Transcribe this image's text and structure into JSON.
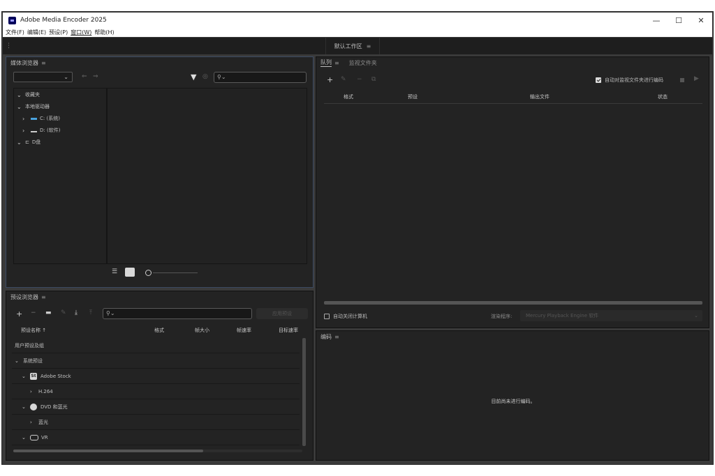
{
  "window": {
    "title": "Adobe Media Encoder 2025",
    "minimize": "—",
    "maximize": "☐",
    "close": "✕"
  },
  "menu": [
    "文件(F)",
    "编辑(E)",
    "预设(P)",
    "窗口(W)",
    "帮助(H)"
  ],
  "workspace": {
    "tab_label": "默认工作区",
    "menu_glyph": "≡"
  },
  "media_browser": {
    "title": "媒体浏览器",
    "menu_glyph": "≡",
    "tree": [
      {
        "label": "收藏夹",
        "arrow": "⌄",
        "level": 0
      },
      {
        "label": "本地驱动器",
        "arrow": "⌄",
        "level": 0
      },
      {
        "label": "C: (系统)",
        "arrow": "›",
        "level": 1
      },
      {
        "label": "D: (软件)",
        "arrow": "›",
        "level": 1
      },
      {
        "label": "D盘",
        "arrow": "⌄",
        "level": 0
      }
    ]
  },
  "preset_browser": {
    "title": "预设浏览器",
    "menu_glyph": "≡",
    "apply_button": "应用预设",
    "columns": [
      "预设名称 ↑",
      "格式",
      "帧大小",
      "帧速率",
      "目标速率"
    ],
    "rows": [
      {
        "label": "用户预设及组",
        "arrow": "",
        "icon": "",
        "indent": 0
      },
      {
        "label": "系统预设",
        "arrow": "⌄",
        "icon": "",
        "indent": 0
      },
      {
        "label": "Adobe Stock",
        "arrow": "⌄",
        "icon": "St",
        "indent": 1
      },
      {
        "label": "H.264",
        "arrow": "›",
        "icon": "",
        "indent": 2
      },
      {
        "label": "DVD 和蓝光",
        "arrow": "⌄",
        "icon": "disc",
        "indent": 1
      },
      {
        "label": "蓝光",
        "arrow": "›",
        "icon": "",
        "indent": 2
      },
      {
        "label": "VR",
        "arrow": "⌄",
        "icon": "vr",
        "indent": 1
      }
    ]
  },
  "queue": {
    "tab_queue": "队列",
    "tab_watch": "监视文件夹",
    "menu_glyph": "≡",
    "auto_encode_label": "自动对监视文件夹进行编码",
    "columns": [
      "格式",
      "预设",
      "输出文件",
      "状态"
    ],
    "shutdown_label": "自动关闭计算机",
    "renderer_label": "渲染程序:",
    "renderer_value": "Mercury Playback Engine 软件"
  },
  "encoding": {
    "title": "编码",
    "menu_glyph": "≡",
    "status": "目前尚未进行编码。"
  }
}
